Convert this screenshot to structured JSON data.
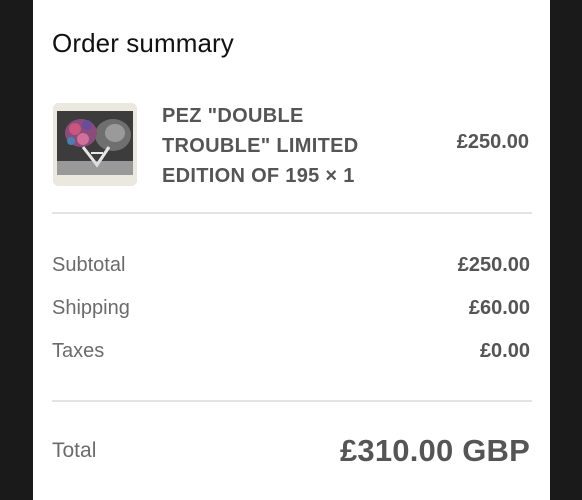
{
  "summary": {
    "title": "Order summary"
  },
  "item": {
    "name": "PEZ \"DOUBLE TROUBLE\" LIMITED EDITION OF 195 × 1",
    "price": "£250.00",
    "thumbnail_icon": "artwork-thumbnail"
  },
  "lines": {
    "subtotal_label": "Subtotal",
    "subtotal_value": "£250.00",
    "shipping_label": "Shipping",
    "shipping_value": "£60.00",
    "taxes_label": "Taxes",
    "taxes_value": "£0.00"
  },
  "total": {
    "label": "Total",
    "value": "£310.00 GBP"
  },
  "colors": {
    "background": "#1a1a1a",
    "panel": "#ffffff",
    "text_primary": "#111111",
    "text_secondary": "#6b6b6b",
    "text_value": "#555555",
    "divider": "#e3e3e3"
  }
}
